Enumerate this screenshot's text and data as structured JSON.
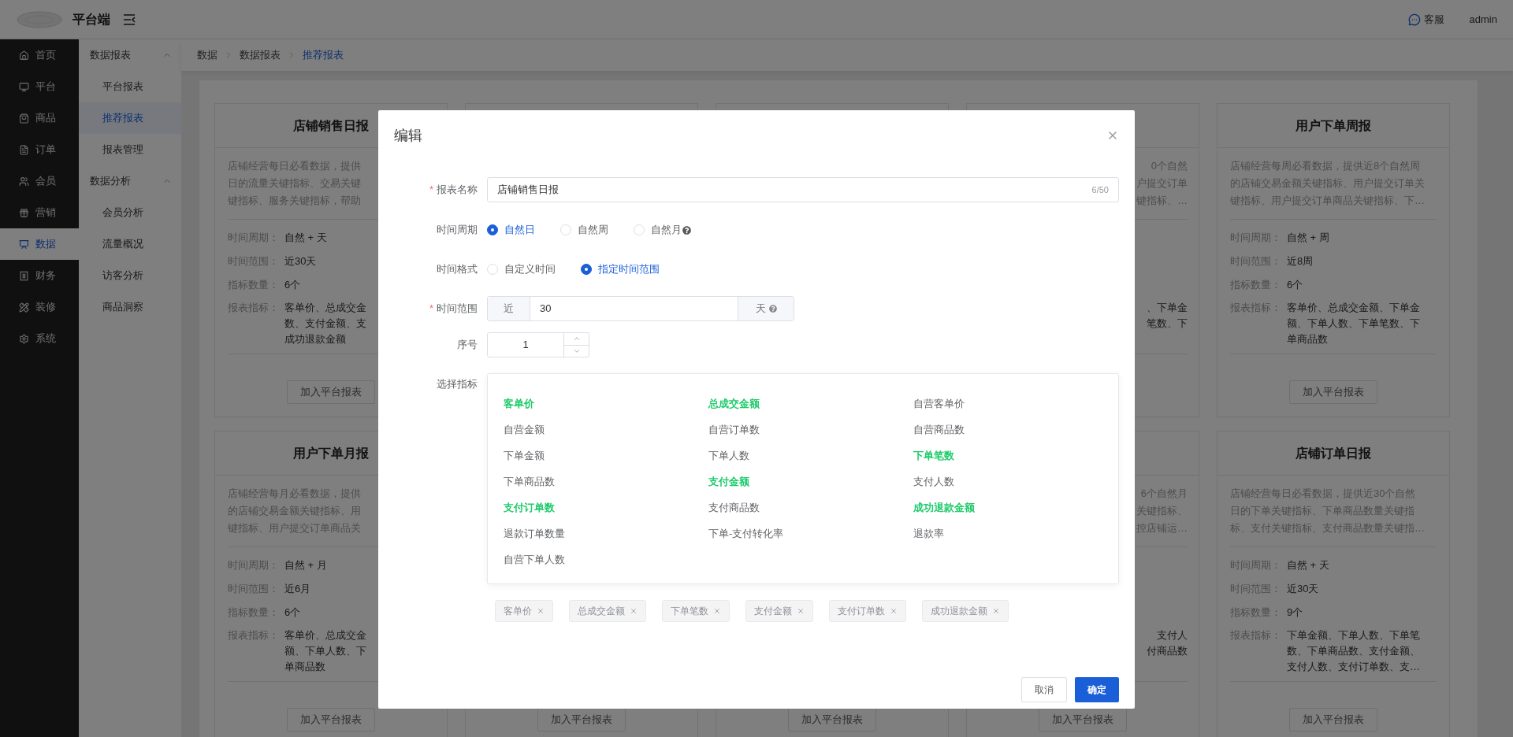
{
  "header": {
    "app_name": "平台端",
    "support": "客服",
    "user": "admin"
  },
  "nav": [
    {
      "label": "首页",
      "selected": false
    },
    {
      "label": "平台",
      "selected": false
    },
    {
      "label": "商品",
      "selected": false
    },
    {
      "label": "订单",
      "selected": false
    },
    {
      "label": "会员",
      "selected": false
    },
    {
      "label": "营销",
      "selected": false
    },
    {
      "label": "数据",
      "selected": true
    },
    {
      "label": "财务",
      "selected": false
    },
    {
      "label": "装修",
      "selected": false
    },
    {
      "label": "系统",
      "selected": false
    }
  ],
  "submenu": [
    {
      "label": "数据报表",
      "expanded": true,
      "children": [
        {
          "label": "平台报表",
          "selected": false
        },
        {
          "label": "推荐报表",
          "selected": true
        },
        {
          "label": "报表管理",
          "selected": false
        }
      ]
    },
    {
      "label": "数据分析",
      "expanded": true,
      "children": [
        {
          "label": "会员分析",
          "selected": false
        },
        {
          "label": "流量概况",
          "selected": false
        },
        {
          "label": "访客分析",
          "selected": false
        },
        {
          "label": "商品洞察",
          "selected": false
        }
      ]
    }
  ],
  "breadcrumb": [
    "数据",
    "数据报表",
    "推荐报表"
  ],
  "cards": [
    {
      "kind": "card",
      "title": "店铺销售日报",
      "description": [
        "店铺经营每日必看数据，提供",
        "日的流量关键指标、交易关键",
        "键指标、服务关键指标，帮助"
      ],
      "fields": [
        {
          "label": "时间周期：",
          "value": "自然 + 天"
        },
        {
          "label": "时间范围：",
          "value": "近30天"
        },
        {
          "label": "指标数量：",
          "value": "6个"
        }
      ],
      "metrics_label": "报表指标：",
      "metrics": [
        "客单价、总成交金",
        "数、支付金额、支",
        "成功退款金额"
      ],
      "button": "加入平台报表"
    },
    {
      "kind": "covered"
    },
    {
      "kind": "covered"
    },
    {
      "kind": "edge",
      "description": [
        "0个自然",
        "户提交订单",
        "键指标、…"
      ],
      "metrics": [
        "、下单金",
        "笔数、下"
      ]
    },
    {
      "kind": "card",
      "title": "用户下单周报",
      "description": [
        "店铺经营每周必看数据，提供近8个自然周",
        "的店铺交易金额关键指标、用户提交订单关",
        "键指标、用户提交订单商品关键指标、下…"
      ],
      "fields": [
        {
          "label": "时间周期：",
          "value": "自然 + 周"
        },
        {
          "label": "时间范围：",
          "value": "近8周"
        },
        {
          "label": "指标数量：",
          "value": "6个"
        }
      ],
      "metrics_label": "报表指标：",
      "metrics": [
        "客单价、总成交金额、下单金",
        "额、下单人数、下单笔数、下",
        "单商品数"
      ],
      "button": "加入平台报表"
    },
    {
      "kind": "card",
      "title": "用户下单月报",
      "description": [
        "店铺经营每月必看数据，提供",
        "的店铺交易金额关键指标、用",
        "键指标、用户提交订单商品关"
      ],
      "fields": [
        {
          "label": "时间周期：",
          "value": "自然 + 月"
        },
        {
          "label": "时间范围：",
          "value": "近6月"
        },
        {
          "label": "指标数量：",
          "value": "6个"
        }
      ],
      "metrics_label": "报表指标：",
      "metrics": [
        "客单价、总成交金",
        "额、下单人数、下",
        "单商品数"
      ],
      "button": "加入平台报表"
    },
    {
      "kind": "covered",
      "button": "加入平台报表"
    },
    {
      "kind": "covered",
      "button": "加入平台报表"
    },
    {
      "kind": "edge",
      "description": [
        "6个自然月",
        "关键指标、",
        "控店铺运…"
      ],
      "metrics": [
        "支付人",
        "付商品数"
      ],
      "button": "加入平台报表"
    },
    {
      "kind": "card",
      "title": "店铺订单日报",
      "description": [
        "店铺经营每日必看数据，提供近30个自然",
        "日的下单关键指标、下单商品数量关键指",
        "标、支付关键指标、支付商品数量关键指…"
      ],
      "fields": [
        {
          "label": "时间周期：",
          "value": "自然 + 天"
        },
        {
          "label": "时间范围：",
          "value": "近30天"
        },
        {
          "label": "指标数量：",
          "value": "9个"
        }
      ],
      "metrics_label": "报表指标：",
      "metrics": [
        "下单金额、下单人数、下单笔",
        "数、下单商品数、支付金额、",
        "支付人数、支付订单数、支…"
      ],
      "button": "加入平台报表"
    }
  ],
  "dialog": {
    "title": "编辑",
    "name_field": {
      "required_mark": "*",
      "label": "报表名称",
      "value": "店铺销售日报",
      "counter": "6/50"
    },
    "period": {
      "label": "时间周期",
      "options": [
        {
          "label": "自然日",
          "selected": true,
          "help": false
        },
        {
          "label": "自然周",
          "selected": false,
          "help": false
        },
        {
          "label": "自然月",
          "selected": false,
          "help": true
        }
      ]
    },
    "format": {
      "label": "时间格式",
      "options": [
        {
          "label": "自定义时间",
          "selected": false,
          "help": false
        },
        {
          "label": "指定时间范围",
          "selected": true,
          "help": false
        }
      ]
    },
    "range": {
      "required_mark": "*",
      "label": "时间范围",
      "prefix": "近",
      "value": "30",
      "suffix": "天"
    },
    "order": {
      "label": "序号",
      "value": "1"
    },
    "metrics": {
      "label": "选择指标",
      "options": [
        {
          "label": "客单价",
          "selected": true
        },
        {
          "label": "总成交金额",
          "selected": true
        },
        {
          "label": "自营客单价",
          "selected": false
        },
        {
          "label": "自营金额",
          "selected": false
        },
        {
          "label": "自营订单数",
          "selected": false
        },
        {
          "label": "自营商品数",
          "selected": false
        },
        {
          "label": "下单金额",
          "selected": false
        },
        {
          "label": "下单人数",
          "selected": false
        },
        {
          "label": "下单笔数",
          "selected": true
        },
        {
          "label": "下单商品数",
          "selected": false
        },
        {
          "label": "支付金额",
          "selected": true
        },
        {
          "label": "支付人数",
          "selected": false
        },
        {
          "label": "支付订单数",
          "selected": true
        },
        {
          "label": "支付商品数",
          "selected": false
        },
        {
          "label": "成功退款金额",
          "selected": true
        },
        {
          "label": "退款订单数量",
          "selected": false
        },
        {
          "label": "下单-支付转化率",
          "selected": false
        },
        {
          "label": "退款率",
          "selected": false
        },
        {
          "label": "自营下单人数",
          "selected": false
        }
      ],
      "tags": [
        "客单价",
        "总成交金额",
        "下单笔数",
        "支付金额",
        "支付订单数",
        "成功退款金额"
      ]
    },
    "buttons": [
      {
        "label": "取消",
        "kind": "default"
      },
      {
        "label": "确定",
        "kind": "primary"
      }
    ]
  }
}
